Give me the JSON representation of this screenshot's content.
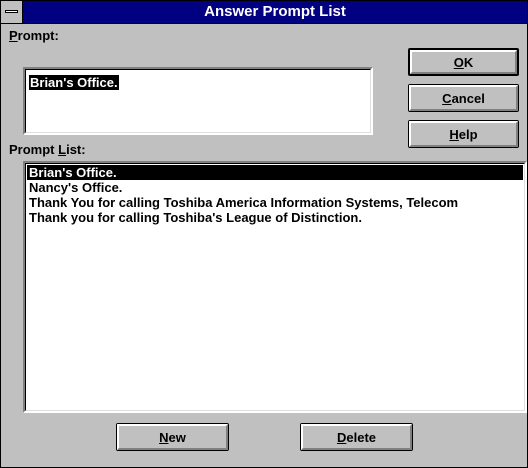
{
  "window": {
    "title": "Answer Prompt List",
    "system_menu_icon": "system-menu-icon"
  },
  "prompt": {
    "label_accel": "P",
    "label_rest": "rompt:",
    "value": "Brian's Office."
  },
  "prompt_list": {
    "label_prefix": "Prompt ",
    "label_accel": "L",
    "label_rest": "ist:",
    "items": [
      "Brian's Office.",
      "Nancy's Office.",
      "Thank You for calling Toshiba America Information Systems, Telecom",
      "Thank you for calling Toshiba's League of Distinction."
    ],
    "selected_index": 0
  },
  "buttons": {
    "ok": {
      "accel": "O",
      "rest": "K"
    },
    "cancel": {
      "accel": "C",
      "rest": "ancel"
    },
    "help": {
      "accel": "H",
      "rest": "elp"
    },
    "new": {
      "accel": "N",
      "rest": "ew"
    },
    "delete": {
      "accel": "D",
      "rest": "elete"
    }
  }
}
